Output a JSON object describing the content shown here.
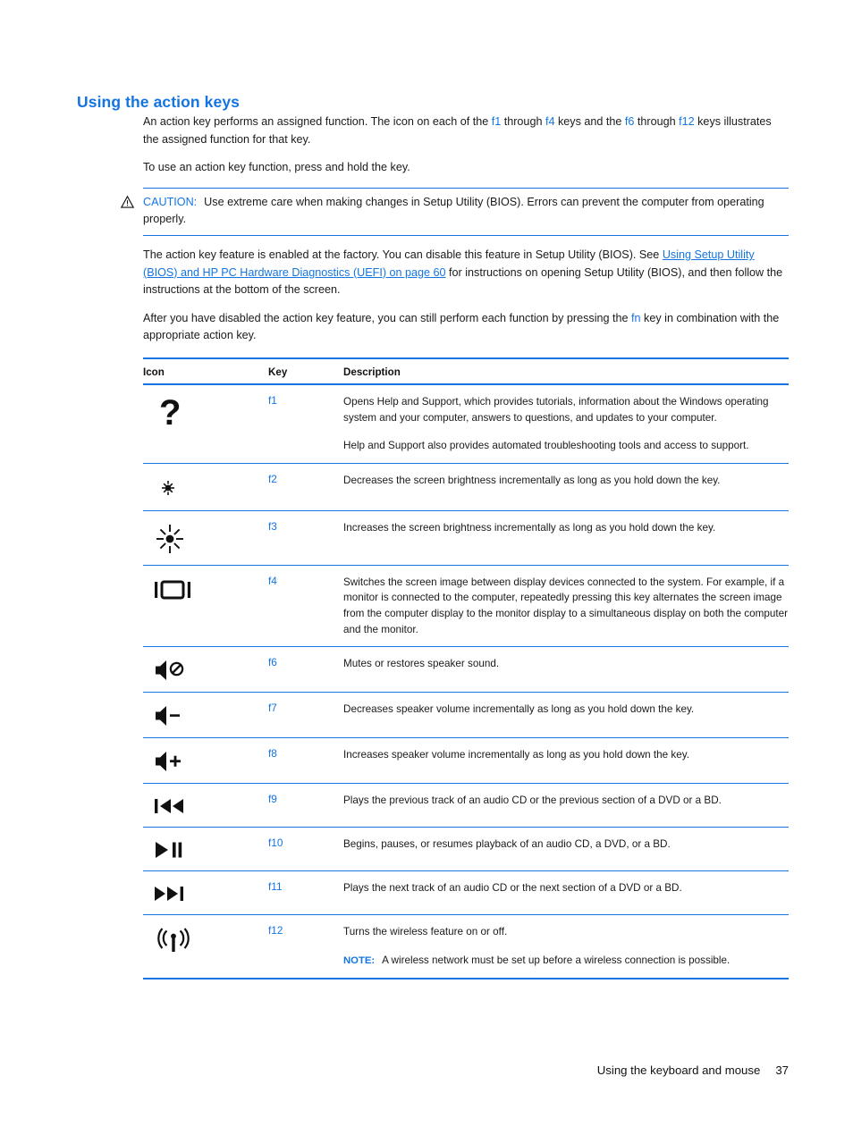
{
  "heading": "Using the action keys",
  "paragraphs": {
    "p1_a": "An action key performs an assigned function. The icon on each of the ",
    "p1_f1": "f1",
    "p1_b": " through ",
    "p1_f4": "f4",
    "p1_c": " keys and the ",
    "p1_f6": "f6",
    "p1_d": " through ",
    "p1_f12": "f12",
    "p1_e": " keys illustrates the assigned function for that key.",
    "p2": "To use an action key function, press and hold the key.",
    "p3_a": "The action key feature is enabled at the factory. You can disable this feature in Setup Utility (BIOS). See ",
    "p3_link": "Using Setup Utility (BIOS) and HP PC Hardware Diagnostics (UEFI) on page 60",
    "p3_b": " for instructions on opening Setup Utility (BIOS), and then follow the instructions at the bottom of the screen.",
    "p4_a": "After you have disabled the action key feature, you can still perform each function by pressing the ",
    "p4_fn": "fn",
    "p4_b": " key in combination with the appropriate action key."
  },
  "caution": {
    "label": "CAUTION:",
    "text": "Use extreme care when making changes in Setup Utility (BIOS). Errors can prevent the computer from operating properly.",
    "icon": "warning-triangle-icon"
  },
  "table": {
    "headers": {
      "icon": "Icon",
      "key": "Key",
      "description": "Description"
    },
    "rows": [
      {
        "icon": "question-mark-icon",
        "key": "f1",
        "desc": [
          "Opens Help and Support, which provides tutorials, information about the Windows operating system and your computer, answers to questions, and updates to your computer.",
          "Help and Support also provides automated troubleshooting tools and access to support."
        ]
      },
      {
        "icon": "brightness-down-icon",
        "key": "f2",
        "desc": [
          "Decreases the screen brightness incrementally as long as you hold down the key."
        ]
      },
      {
        "icon": "brightness-up-icon",
        "key": "f3",
        "desc": [
          "Increases the screen brightness incrementally as long as you hold down the key."
        ]
      },
      {
        "icon": "switch-display-icon",
        "key": "f4",
        "desc": [
          "Switches the screen image between display devices connected to the system. For example, if a monitor is connected to the computer, repeatedly pressing this key alternates the screen image from the computer display to the monitor display to a simultaneous display on both the computer and the monitor."
        ]
      },
      {
        "icon": "speaker-mute-icon",
        "key": "f6",
        "desc": [
          "Mutes or restores speaker sound."
        ]
      },
      {
        "icon": "volume-down-icon",
        "key": "f7",
        "desc": [
          "Decreases speaker volume incrementally as long as you hold down the key."
        ]
      },
      {
        "icon": "volume-up-icon",
        "key": "f8",
        "desc": [
          "Increases speaker volume incrementally as long as you hold down the key."
        ]
      },
      {
        "icon": "previous-track-icon",
        "key": "f9",
        "desc": [
          "Plays the previous track of an audio CD or the previous section of a DVD or a BD."
        ]
      },
      {
        "icon": "play-pause-icon",
        "key": "f10",
        "desc": [
          "Begins, pauses, or resumes playback of an audio CD, a DVD, or a BD."
        ]
      },
      {
        "icon": "next-track-icon",
        "key": "f11",
        "desc": [
          "Plays the next track of an audio CD or the next section of a DVD or a BD."
        ]
      },
      {
        "icon": "wireless-icon",
        "key": "f12",
        "desc": [
          "Turns the wireless feature on or off."
        ],
        "note_label": "NOTE:",
        "note_text": "A wireless network must be set up before a wireless connection is possible."
      }
    ]
  },
  "footer": {
    "title": "Using the keyboard and mouse",
    "page": "37"
  },
  "colors": {
    "accent_blue": "#1475e1",
    "text": "#1a1a1a"
  }
}
